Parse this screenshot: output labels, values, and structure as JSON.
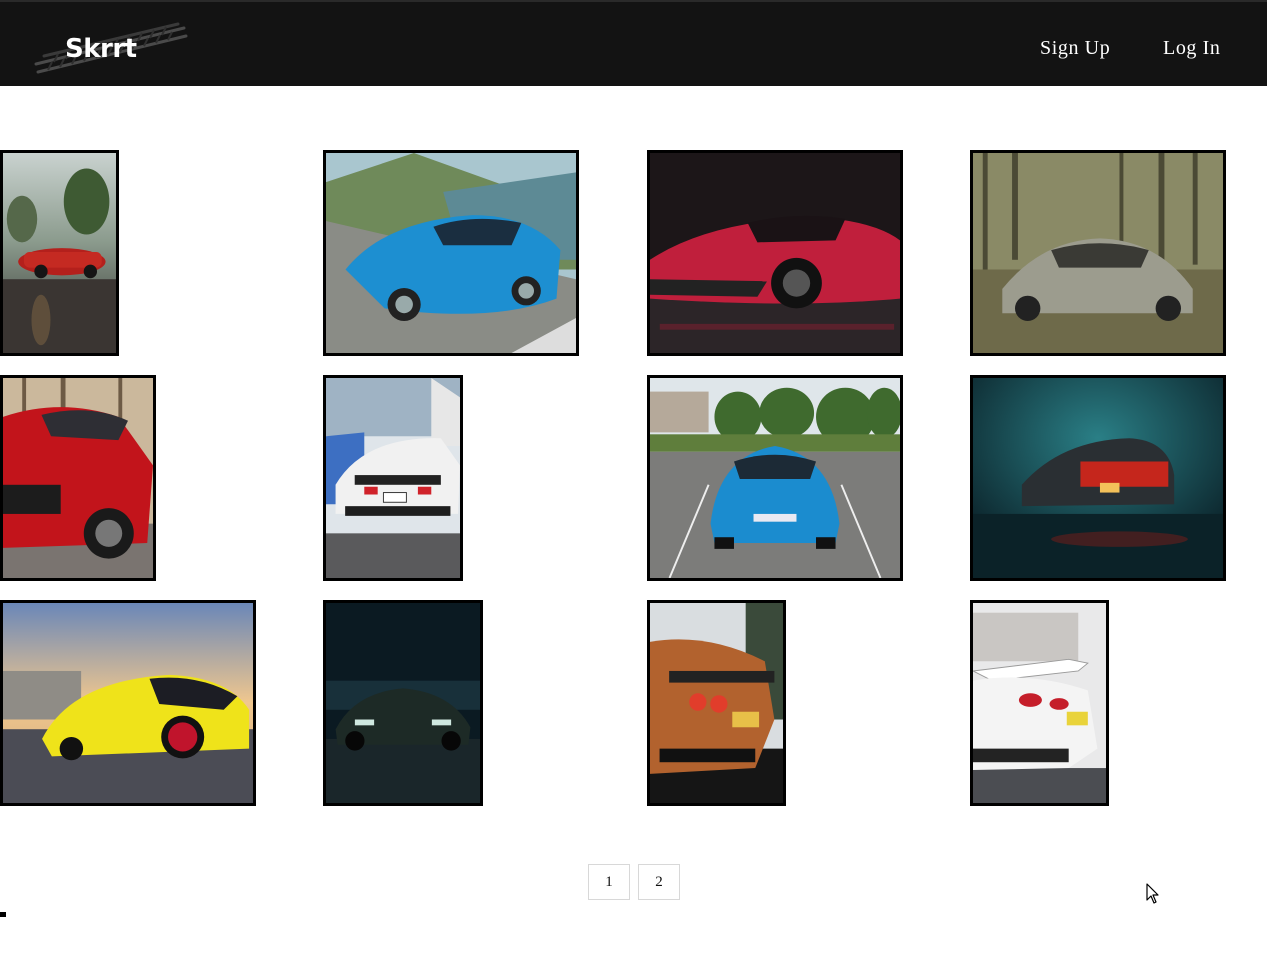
{
  "header": {
    "logo_text": "Skrrt",
    "nav": {
      "signup": "Sign Up",
      "login": "Log In"
    }
  },
  "gallery": {
    "items": [
      {
        "subject": "red-convertible-wet-road"
      },
      {
        "subject": "blue-supercar-mountain-road"
      },
      {
        "subject": "red-sportscar-studio"
      },
      {
        "subject": "silver-coupe-forest-leaves"
      },
      {
        "subject": "red-hatchback-closeup"
      },
      {
        "subject": "white-sportscar-rear"
      },
      {
        "subject": "blue-coupe-parking-lot"
      },
      {
        "subject": "car-red-taillights-teal-fog"
      },
      {
        "subject": "yellow-coupe-red-wheels"
      },
      {
        "subject": "dark-coupe-night"
      },
      {
        "subject": "bronze-gt-car-rear"
      },
      {
        "subject": "white-sportscar-rear-wing"
      }
    ]
  },
  "pagination": {
    "pages": [
      "1",
      "2"
    ]
  },
  "icons": {
    "cursor": "mouse-pointer-icon"
  },
  "colors": {
    "navbar": "#131313",
    "nav_text": "#ffffff",
    "thumb_border": "#000000"
  }
}
